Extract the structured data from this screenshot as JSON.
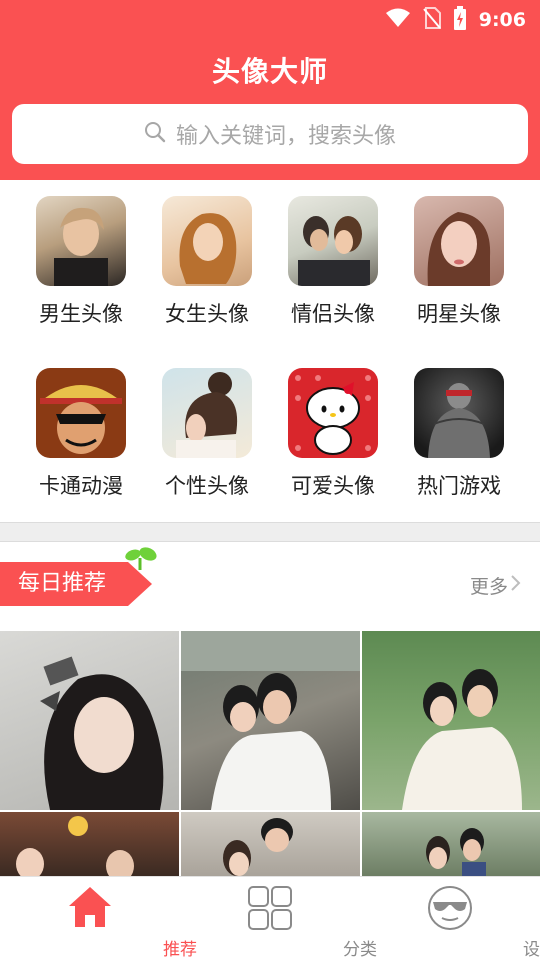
{
  "status_bar": {
    "time": "9:06"
  },
  "header": {
    "title": "头像大师",
    "search_placeholder": "输入关键词，搜索头像"
  },
  "categories": [
    {
      "label": "男生头像"
    },
    {
      "label": "女生头像"
    },
    {
      "label": "情侣头像"
    },
    {
      "label": "明星头像"
    },
    {
      "label": "卡通动漫"
    },
    {
      "label": "个性头像"
    },
    {
      "label": "可爱头像"
    },
    {
      "label": "热门游戏"
    }
  ],
  "daily": {
    "title": "每日推荐",
    "more": "更多"
  },
  "tabs": [
    {
      "label": "推荐",
      "active": true
    },
    {
      "label": "分类",
      "active": false
    },
    {
      "label": "设计",
      "active": false
    }
  ],
  "colors": {
    "brand": "#fa5152",
    "inactive": "#8a8a8a"
  }
}
